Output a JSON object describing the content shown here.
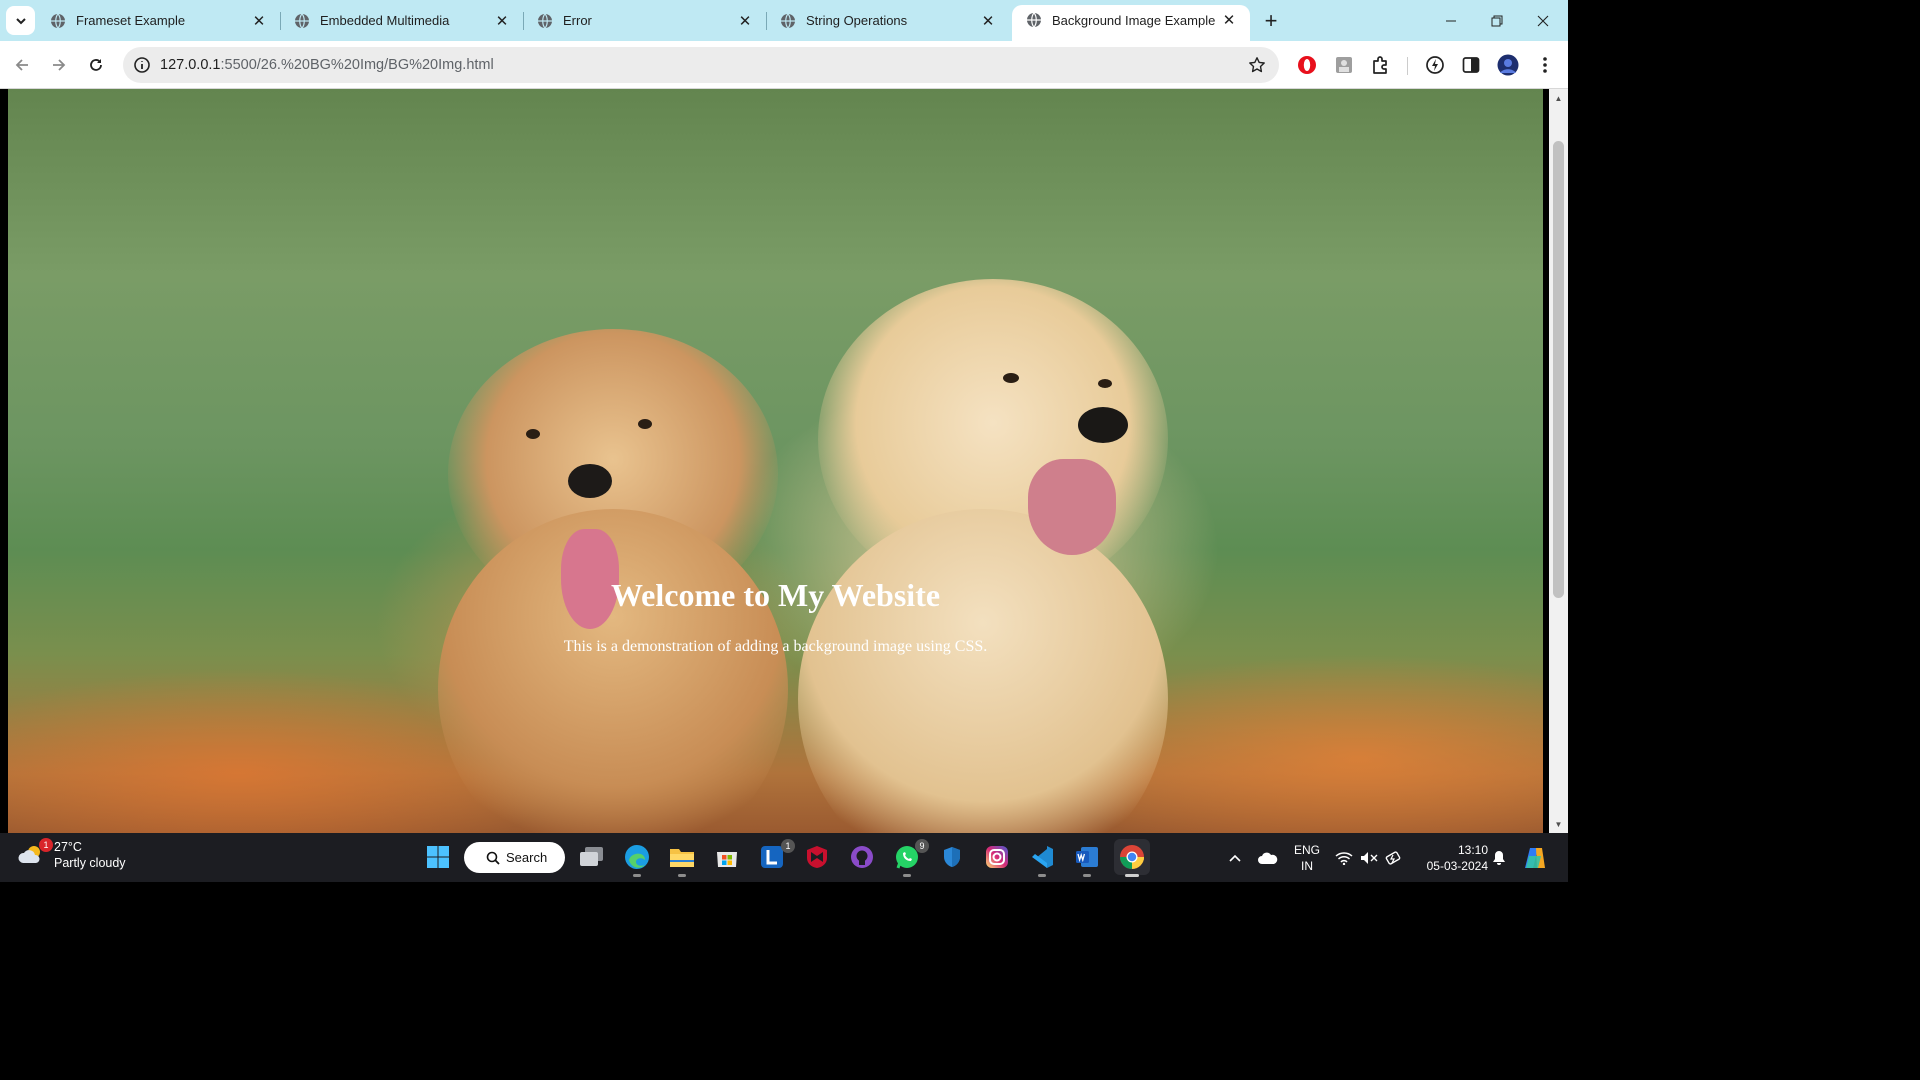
{
  "browser": {
    "tabs": [
      {
        "title": "Frameset Example",
        "active": false
      },
      {
        "title": "Embedded Multimedia",
        "active": false
      },
      {
        "title": "Error",
        "active": false
      },
      {
        "title": "String Operations",
        "active": false
      },
      {
        "title": "Background Image Example",
        "active": true
      }
    ],
    "new_tab": "+",
    "address": {
      "host": "127.0.0.1",
      "path": ":5500/26.%20BG%20Img/BG%20Img.html"
    }
  },
  "page": {
    "heading": "Welcome to My Website",
    "paragraph": "This is a demonstration of adding a background image using CSS."
  },
  "taskbar": {
    "weather": {
      "temp": "27°C",
      "condition": "Partly cloudy",
      "badge": "1"
    },
    "search_label": "Search",
    "badges": {
      "lens": "1",
      "whatsapp": "9"
    },
    "language": {
      "line1": "ENG",
      "line2": "IN"
    },
    "clock": {
      "time": "13:10",
      "date": "05-03-2024"
    }
  },
  "colors": {
    "tabstrip": "#bfe9f3",
    "taskbar": "#1c1d22",
    "accent": "#1a73e8"
  }
}
